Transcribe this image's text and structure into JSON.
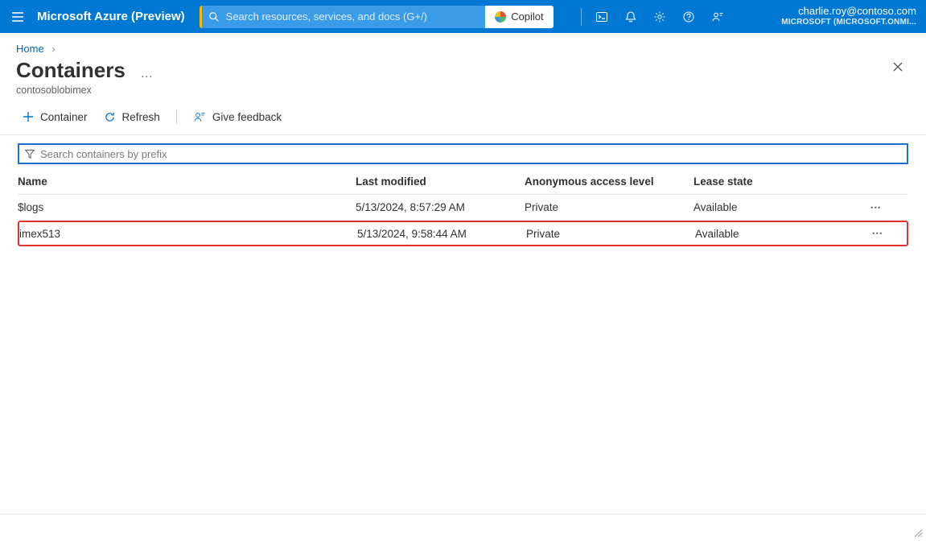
{
  "topbar": {
    "brand": "Microsoft Azure (Preview)",
    "search_placeholder": "Search resources, services, and docs (G+/)",
    "copilot_label": "Copilot",
    "account_email": "charlie.roy@contoso.com",
    "account_org": "MICROSOFT (MICROSOFT.ONMI..."
  },
  "breadcrumb": {
    "home": "Home"
  },
  "page": {
    "title": "Containers",
    "subtitle": "contosoblobimex"
  },
  "commands": {
    "add_container": "Container",
    "refresh": "Refresh",
    "give_feedback": "Give feedback"
  },
  "filter": {
    "placeholder": "Search containers by prefix"
  },
  "table": {
    "headers": {
      "name": "Name",
      "last_modified": "Last modified",
      "access": "Anonymous access level",
      "lease": "Lease state"
    },
    "rows": [
      {
        "name": "$logs",
        "last_modified": "5/13/2024, 8:57:29 AM",
        "access": "Private",
        "lease": "Available",
        "highlight": false
      },
      {
        "name": "imex513",
        "last_modified": "5/13/2024, 9:58:44 AM",
        "access": "Private",
        "lease": "Available",
        "highlight": true
      }
    ]
  }
}
